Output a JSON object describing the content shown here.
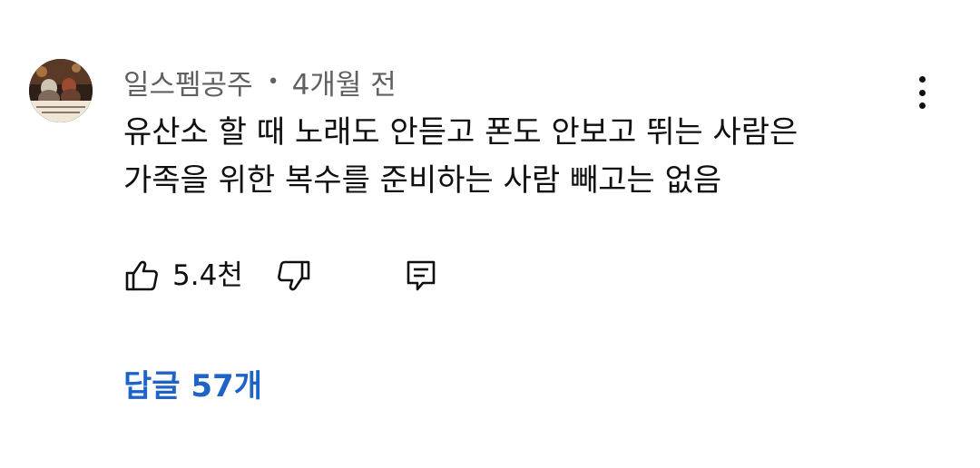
{
  "comment": {
    "author": "일스펨공주",
    "separator": "•",
    "time_ago": "4개월 전",
    "text_lines": [
      "유산소 할 때 노래도 안듣고 폰도 안보고 뛰는 사람은",
      "가족을 위한 복수를 준비하는 사람 빼고는 없음"
    ],
    "like_count": "5.4천",
    "replies_label": "답글 57개"
  },
  "icons": {
    "avatar": "avatar-image",
    "menu": "more-vert-icon",
    "like": "thumbs-up-icon",
    "dislike": "thumbs-down-icon",
    "reply": "comment-reply-icon"
  },
  "colors": {
    "text_primary": "#0f0f0f",
    "text_secondary": "#606060",
    "link_blue": "#1e64c8"
  }
}
